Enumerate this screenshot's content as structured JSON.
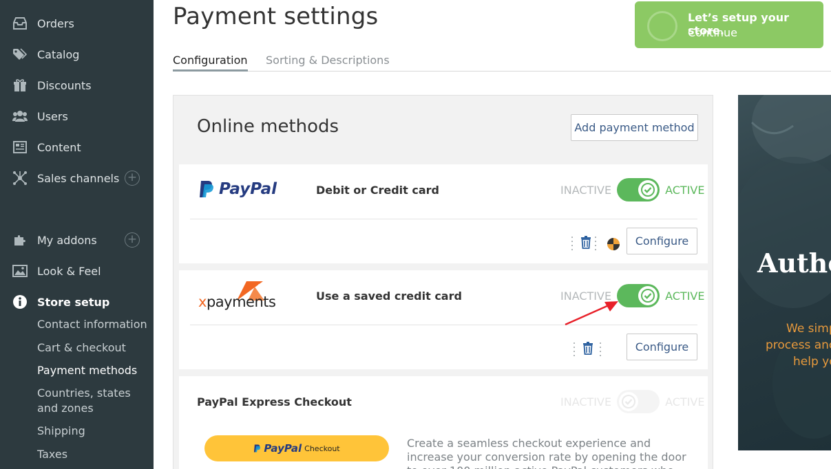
{
  "sidebar": {
    "items": [
      {
        "label": "Orders",
        "icon": "orders-icon"
      },
      {
        "label": "Catalog",
        "icon": "tag-icon"
      },
      {
        "label": "Discounts",
        "icon": "gift-icon"
      },
      {
        "label": "Users",
        "icon": "users-icon"
      },
      {
        "label": "Content",
        "icon": "content-icon"
      },
      {
        "label": "Sales channels",
        "icon": "network-icon"
      },
      {
        "label": "My addons",
        "icon": "puzzle-icon"
      },
      {
        "label": "Look & Feel",
        "icon": "image-icon"
      },
      {
        "label": "Store setup",
        "icon": "info-icon"
      }
    ],
    "sub_items": [
      "Contact information",
      "Cart & checkout",
      "Payment methods",
      "Countries, states and zones",
      "Shipping",
      "Taxes"
    ]
  },
  "header": {
    "title": "Payment settings",
    "tabs": [
      "Configuration",
      "Sorting & Descriptions"
    ]
  },
  "setup_banner": {
    "title": "Let’s setup your store.",
    "link": "Continue"
  },
  "panel": {
    "title": "Online methods",
    "add_button": "Add payment method",
    "inactive_label": "INACTIVE",
    "active_label": "ACTIVE",
    "configure_label": "Configure",
    "methods": [
      {
        "logo": "PayPal",
        "name": "Debit or Credit card",
        "active": true
      },
      {
        "logo": "xpayments",
        "logo_badge": "x9",
        "name": "Use a saved credit card",
        "active": true
      },
      {
        "name": "PayPal Express Checkout",
        "active": false,
        "button_brand": "PayPal",
        "button_text": "Checkout",
        "description": "Create a seamless checkout experience and increase your conversion rate by opening the door to over 100 million active PayPal customers who look for and use"
      }
    ]
  },
  "promo": {
    "title": "Autho",
    "text_lines": [
      "We simp",
      "process anc",
      "help yo"
    ]
  },
  "colors": {
    "sidebar_bg": "#2d3a3f",
    "toggle_on": "#5cb85c",
    "banner": "#8cc964",
    "link": "#3a5a86",
    "promo_accent": "#e89a3c"
  }
}
